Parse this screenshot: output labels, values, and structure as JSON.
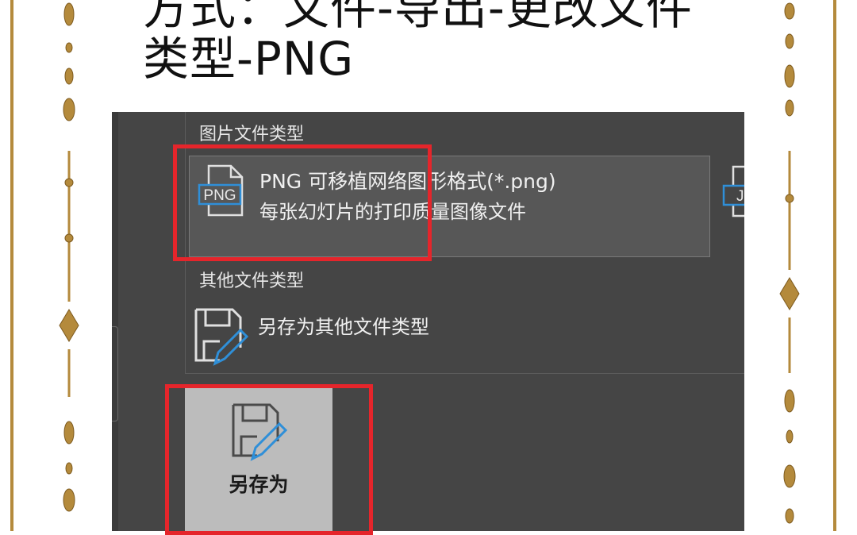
{
  "headline": {
    "line1": "方式：文件-导出-更改文件",
    "line2": "类型-PNG"
  },
  "export_panel": {
    "image_section_title": "图片文件类型",
    "png_option": {
      "icon_text": "PNG",
      "title": "PNG 可移植网络图形格式(*.png)",
      "description": "每张幻灯片的打印质量图像文件"
    },
    "jpg_option": {
      "icon_text": "JP"
    },
    "other_section_title": "其他文件类型",
    "save_as_other": {
      "label": "另存为其他文件类型"
    },
    "save_as_button": {
      "label": "另存为"
    }
  },
  "colors": {
    "highlight": "#e5252b",
    "panel_bg": "#454545",
    "frame_gold": "#b48a3c",
    "icon_blue": "#2f8fd8"
  }
}
